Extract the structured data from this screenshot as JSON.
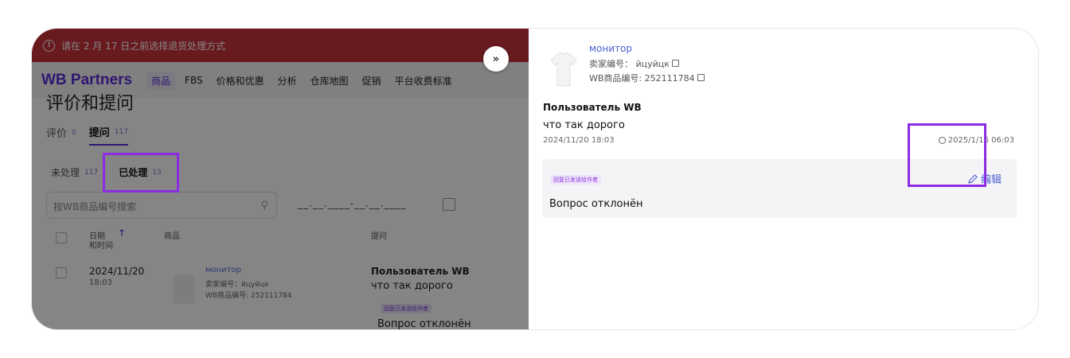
{
  "banner": {
    "text": "请在 2 月 17 日之前选择退货处理方式"
  },
  "nav": {
    "brand": "WB Partners",
    "items": [
      "商品",
      "FBS",
      "价格和优惠",
      "分析",
      "仓库地图",
      "促销",
      "平台收费标准"
    ]
  },
  "page": {
    "title": "评价和提问"
  },
  "tabs": [
    {
      "label": "评价",
      "count": "0"
    },
    {
      "label": "提问",
      "count": "117"
    }
  ],
  "filters": [
    {
      "label": "未处理",
      "count": "117"
    },
    {
      "label": "已处理",
      "count": "13"
    }
  ],
  "search": {
    "placeholder": "按WB商品编号搜索"
  },
  "daterange": {
    "value": "__.__.____-__.__.____"
  },
  "table": {
    "col_date": "日期",
    "col_time": "和时间",
    "col_product": "商品",
    "col_question": "提问",
    "row": {
      "date": "2024/11/20",
      "time": "18:03",
      "product_name": "монитор",
      "seller_code": "卖家编号：йцуйцк",
      "wb_code": "WB商品编号: 252111784",
      "user": "Пользователь WB",
      "question": "что так дорого",
      "tag": "回复已发送给作者",
      "answer": "Вопрос отклонён"
    }
  },
  "drawer": {
    "product_name": "монитор",
    "seller_code": "卖家编号： йцуйцк",
    "wb_code": "WB商品编号: 252111784",
    "user": "Пользователь WB",
    "question": "что так дорого",
    "question_date": "2024/11/20 18:03",
    "answer_timestamp": "2025/1/16 06:03",
    "answer_tag": "回复已发送给作者",
    "answer_text": "Вопрос отклонён",
    "edit_label": "编辑"
  },
  "controls": {
    "expand_glyph": "»"
  },
  "colors": {
    "accent": "#8b2be2",
    "brand": "#5a2bd6",
    "link": "#4a5fd0",
    "banner": "#c7323c"
  }
}
